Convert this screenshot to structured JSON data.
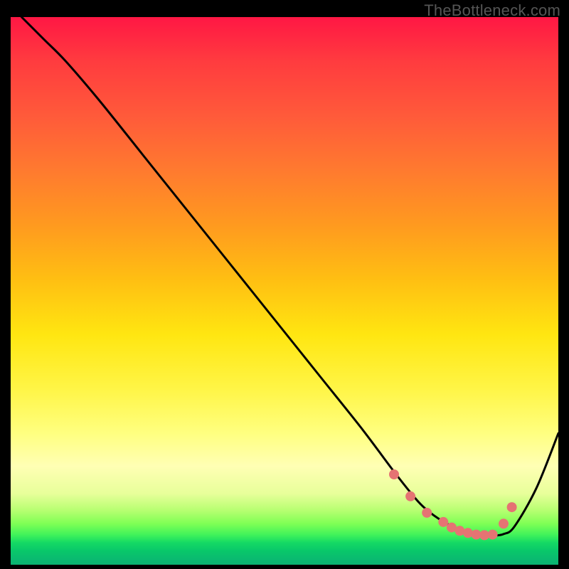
{
  "attribution": "TheBottleneck.com",
  "chart_data": {
    "type": "line",
    "title": "",
    "xlabel": "",
    "ylabel": "",
    "xlim": [
      0,
      100
    ],
    "ylim": [
      0,
      100
    ],
    "grid": false,
    "legend": false,
    "series": [
      {
        "name": "curve",
        "color": "#000000",
        "x": [
          2,
          6,
          10,
          16,
          24,
          32,
          40,
          48,
          56,
          64,
          70,
          74,
          76,
          78,
          80,
          82,
          84,
          86,
          88,
          90,
          92,
          96,
          100
        ],
        "y": [
          100,
          96,
          92,
          85,
          75,
          65,
          55,
          45,
          35,
          25,
          17,
          12,
          10,
          8.5,
          7.3,
          6.2,
          5.6,
          5.3,
          5.3,
          5.6,
          7.0,
          14,
          24
        ]
      },
      {
        "name": "markers",
        "type": "scatter",
        "color": "#e57373",
        "x": [
          70,
          73,
          76,
          79,
          80.5,
          82,
          83.5,
          85,
          86.5,
          88,
          90,
          91.5
        ],
        "y": [
          16.5,
          12.5,
          9.5,
          7.8,
          6.8,
          6.2,
          5.8,
          5.5,
          5.4,
          5.5,
          7.5,
          10.5
        ]
      }
    ],
    "background_gradient_stops": [
      {
        "pos": 0.0,
        "color": "#ff1744"
      },
      {
        "pos": 0.08,
        "color": "#ff3b3f"
      },
      {
        "pos": 0.18,
        "color": "#ff5a3a"
      },
      {
        "pos": 0.28,
        "color": "#ff7a2f"
      },
      {
        "pos": 0.38,
        "color": "#ff9a1f"
      },
      {
        "pos": 0.48,
        "color": "#ffbf12"
      },
      {
        "pos": 0.58,
        "color": "#ffe611"
      },
      {
        "pos": 0.68,
        "color": "#fff547"
      },
      {
        "pos": 0.76,
        "color": "#ffff80"
      },
      {
        "pos": 0.82,
        "color": "#ffffb4"
      },
      {
        "pos": 0.87,
        "color": "#e8ff9a"
      },
      {
        "pos": 0.9,
        "color": "#b8ff72"
      },
      {
        "pos": 0.925,
        "color": "#7fff55"
      },
      {
        "pos": 0.945,
        "color": "#41f35a"
      },
      {
        "pos": 0.96,
        "color": "#14d964"
      },
      {
        "pos": 0.975,
        "color": "#09c76a"
      },
      {
        "pos": 0.99,
        "color": "#0aba70"
      },
      {
        "pos": 1.0,
        "color": "#0bb272"
      }
    ]
  }
}
